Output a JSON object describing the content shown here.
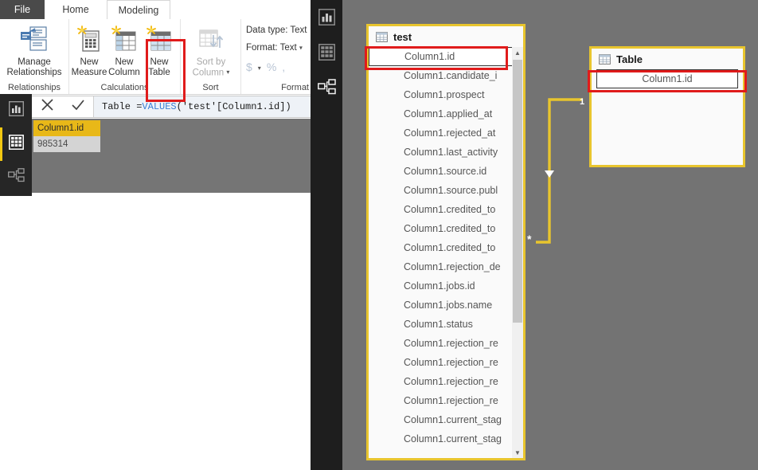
{
  "app": {
    "ribbon": {
      "tabs": [
        {
          "label": "File",
          "id": "file"
        },
        {
          "label": "Home",
          "id": "home"
        },
        {
          "label": "Modeling",
          "id": "modeling"
        }
      ],
      "groups": [
        {
          "id": "relationships",
          "label": "Relationships"
        },
        {
          "id": "calculations",
          "label": "Calculations"
        },
        {
          "id": "sort",
          "label": "Sort"
        },
        {
          "id": "formatting",
          "label": "Format"
        }
      ],
      "buttons": {
        "manage_relationships": "Manage\nRelationships",
        "manage_relationships_l1": "Manage",
        "manage_relationships_l2": "Relationships",
        "new_measure_l1": "New",
        "new_measure_l2": "Measure",
        "new_column_l1": "New",
        "new_column_l2": "Column",
        "new_table_l1": "New",
        "new_table_l2": "Table",
        "sort_by_column_l1": "Sort by",
        "sort_by_column_l2": "Column"
      },
      "formatting": {
        "data_type": "Data type: Text",
        "format": "Format: Text",
        "currency_symbol": "$",
        "percent_symbol": "%",
        "comma_symbol": ","
      }
    },
    "formula_bar": {
      "cancel_icon": "cancel-icon",
      "accept_icon": "accept-icon",
      "text_prefix": "Table = ",
      "function_name": "VALUES",
      "text_suffix": "('test'[Column1.id])",
      "full_text": "Table = VALUES('test'[Column1.id])"
    },
    "data_preview": {
      "column_header": "Column1.id",
      "rows": [
        "985314"
      ]
    },
    "nav_left": [
      {
        "id": "report-view",
        "icon": "report-view-icon",
        "active": false
      },
      {
        "id": "data-view",
        "icon": "data-view-icon",
        "active": true
      },
      {
        "id": "model-view",
        "icon": "model-view-icon",
        "active": false
      }
    ]
  },
  "model": {
    "nav_right": [
      {
        "id": "report-view",
        "icon": "report-view-icon",
        "active": false
      },
      {
        "id": "data-view",
        "icon": "data-view-icon",
        "active": false
      },
      {
        "id": "model-view",
        "icon": "model-view-icon",
        "active": true
      }
    ],
    "tables": [
      {
        "id": "test",
        "name": "test",
        "fields": [
          "Column1.id",
          "Column1.candidate_i",
          "Column1.prospect",
          "Column1.applied_at",
          "Column1.rejected_at",
          "Column1.last_activity",
          "Column1.source.id",
          "Column1.source.publ",
          "Column1.credited_to",
          "Column1.credited_to",
          "Column1.credited_to",
          "Column1.rejection_de",
          "Column1.jobs.id",
          "Column1.jobs.name",
          "Column1.status",
          "Column1.rejection_re",
          "Column1.rejection_re",
          "Column1.rejection_re",
          "Column1.rejection_re",
          "Column1.current_stag",
          "Column1.current_stag"
        ],
        "selected_field": "Column1.id"
      },
      {
        "id": "table",
        "name": "Table",
        "fields": [
          "Column1.id"
        ],
        "selected_field": "Column1.id"
      }
    ],
    "relationship": {
      "one_label": "1",
      "many_label": "*",
      "line_color": "#e8c52e"
    }
  },
  "colors": {
    "accent_yellow": "#f2c811",
    "card_border": "#e8c52e",
    "annotation_red": "#e01b1b",
    "canvas_gray": "#737373",
    "rail_dark": "#1e1e1e",
    "grid_header": "#e8b818"
  }
}
